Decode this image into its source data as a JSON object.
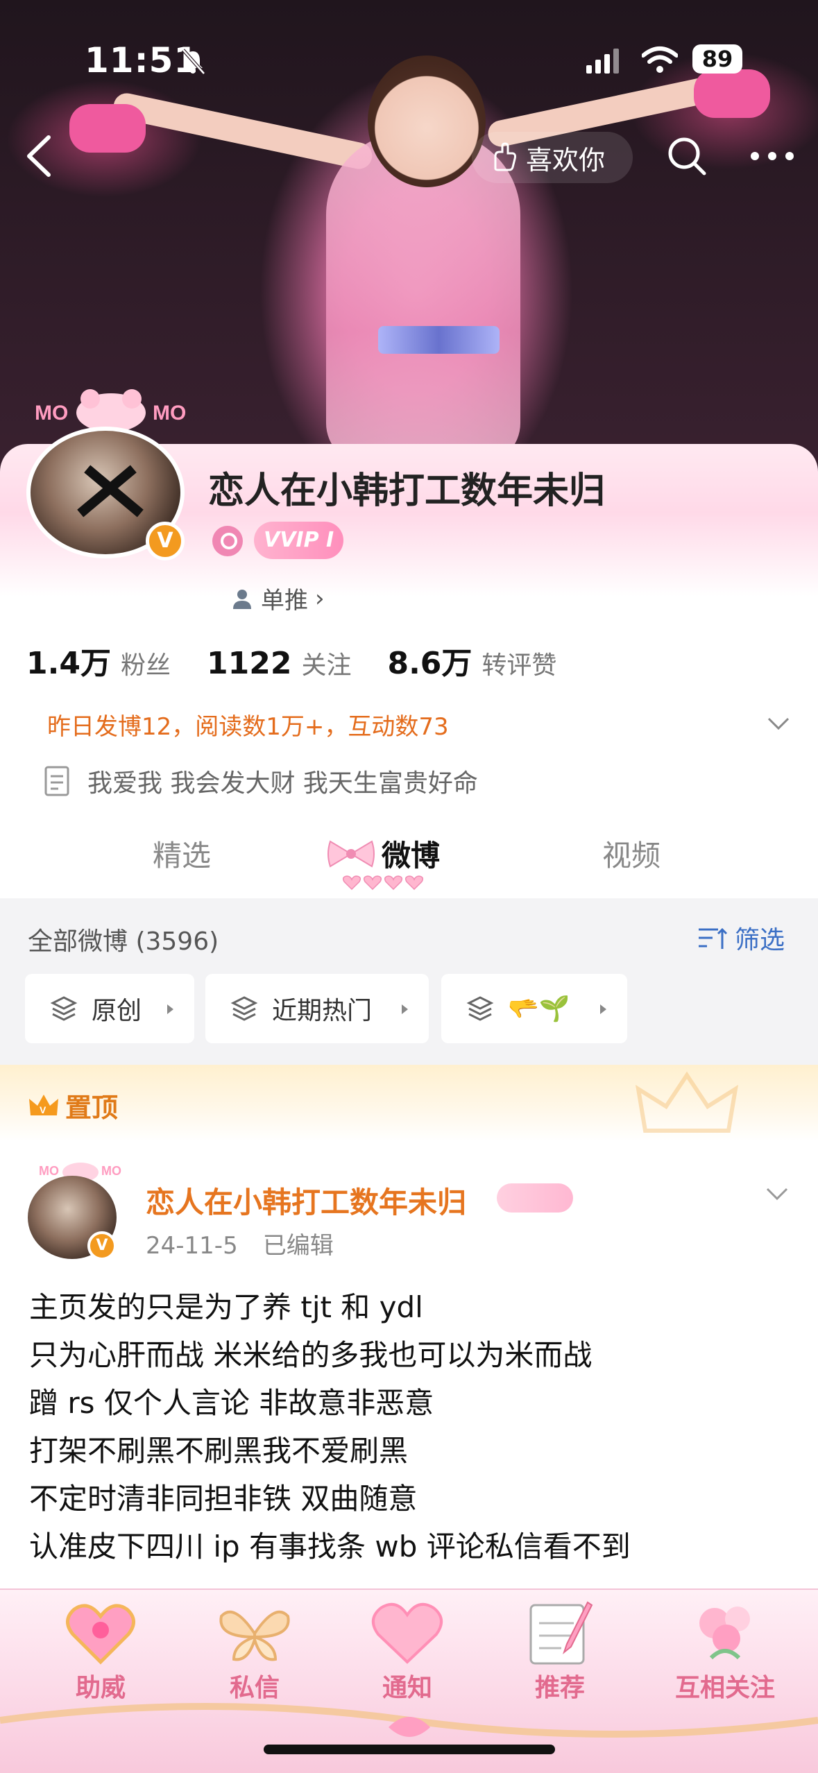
{
  "status_bar": {
    "time": "11:51",
    "battery": "89"
  },
  "header": {
    "like_button_label": "喜欢你"
  },
  "profile": {
    "username": "恋人在小韩打工数年未归",
    "vvip_label": "VVIP I",
    "verified_mark": "V",
    "dantui_label": "单推",
    "stats": [
      {
        "value": "1.4万",
        "label": "粉丝"
      },
      {
        "value": "1122",
        "label": "关注"
      },
      {
        "value": "8.6万",
        "label": "转评赞"
      }
    ],
    "activity": "昨日发博12，阅读数1万+，互动数73",
    "bio": "我爱我 我会发大财 我天生富贵好命"
  },
  "tabs": [
    "精选",
    "微博",
    "视频"
  ],
  "filters": {
    "all_weibo": "全部微博 (3596)",
    "filter_label": "筛选",
    "chips": [
      "原创",
      "近期热门",
      "🫳🌱"
    ]
  },
  "pinned": {
    "label": "置顶",
    "post": {
      "author": "恋人在小韩打工数年未归",
      "date": "24-11-5",
      "edited": "已编辑",
      "lines": [
        "主页发的只是为了养 tjt 和 ydl",
        "只为心肝而战 米米给的多我也可以为米而战",
        "蹭 rs 仅个人言论 非故意非恶意",
        "打架不刷黑不刷黑我不爱刷黑",
        "不定时清非同担非铁 双曲随意",
        "认准皮下四川 ip 有事找条 wb 评论私信看不到"
      ]
    }
  },
  "bottom_bar": [
    "助威",
    "私信",
    "通知",
    "推荐",
    "互相关注"
  ],
  "colors": {
    "accent_orange": "#e6751f",
    "link_blue": "#3b6fc5",
    "pink": "#e26a8e"
  }
}
